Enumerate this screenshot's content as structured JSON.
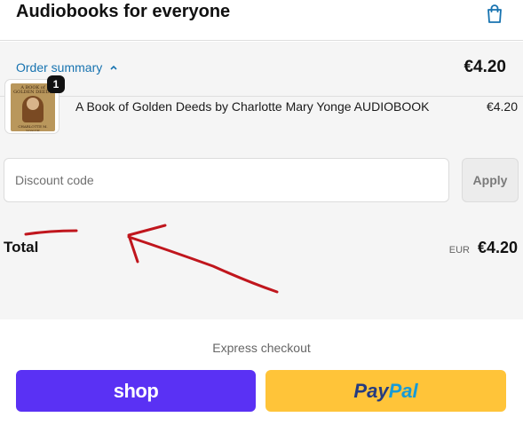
{
  "header": {
    "store_name": "Audiobooks for everyone",
    "cart_icon": "shopping-bag-icon"
  },
  "summary": {
    "toggle_label": "Order summary",
    "toggle_icon": "chevron-up-icon",
    "total": "€4.20"
  },
  "line_item": {
    "quantity": "1",
    "title": "A Book of Golden Deeds by Charlotte Mary Yonge AUDIOBOOK",
    "price": "€4.20",
    "cover_text": [
      "A BOOK of",
      "GOLDEN DEEDS",
      "CHARLOTTE M. YONGE"
    ]
  },
  "discount": {
    "placeholder": "Discount code",
    "value": "",
    "apply_label": "Apply"
  },
  "total": {
    "label": "Total",
    "currency": "EUR",
    "amount": "€4.20"
  },
  "express_checkout": {
    "label": "Express checkout",
    "shop_label": "shop",
    "paypal_label_dark": "Pay",
    "paypal_label_light": "Pal"
  },
  "colors": {
    "link": "#1773b0",
    "shop_purple": "#5a31f4",
    "paypal_yellow": "#ffc439",
    "annotation_red": "#c0161d"
  }
}
